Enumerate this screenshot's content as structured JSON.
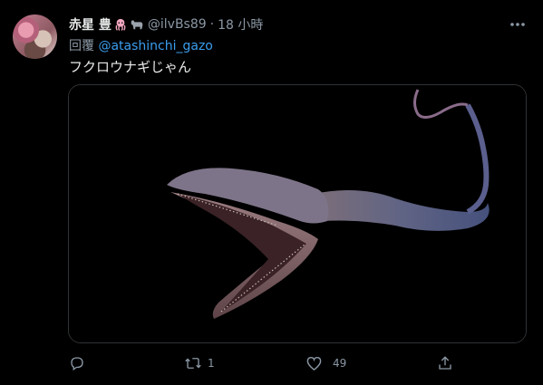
{
  "tweet": {
    "display_name": "赤星 豊",
    "name_emojis": [
      "octopus-icon",
      "black-bull-icon"
    ],
    "handle": "@ilvBs89",
    "separator": "·",
    "time": "18 小時",
    "reply_prefix": "回覆",
    "reply_to": "@atashinchi_gazo",
    "text": "フクロウナギじゃん",
    "media_description": "gulper-eel-photo"
  },
  "actions": {
    "reply": {
      "icon": "reply-icon",
      "count": ""
    },
    "retweet": {
      "icon": "retweet-icon",
      "count": "1"
    },
    "like": {
      "icon": "heart-icon",
      "count": "49"
    },
    "share": {
      "icon": "share-icon",
      "count": ""
    }
  },
  "colors": {
    "background": "#000000",
    "primary_text": "#e7e9ea",
    "secondary_text": "#8b98a5",
    "link": "#3b9ded",
    "border": "#2f3336"
  }
}
